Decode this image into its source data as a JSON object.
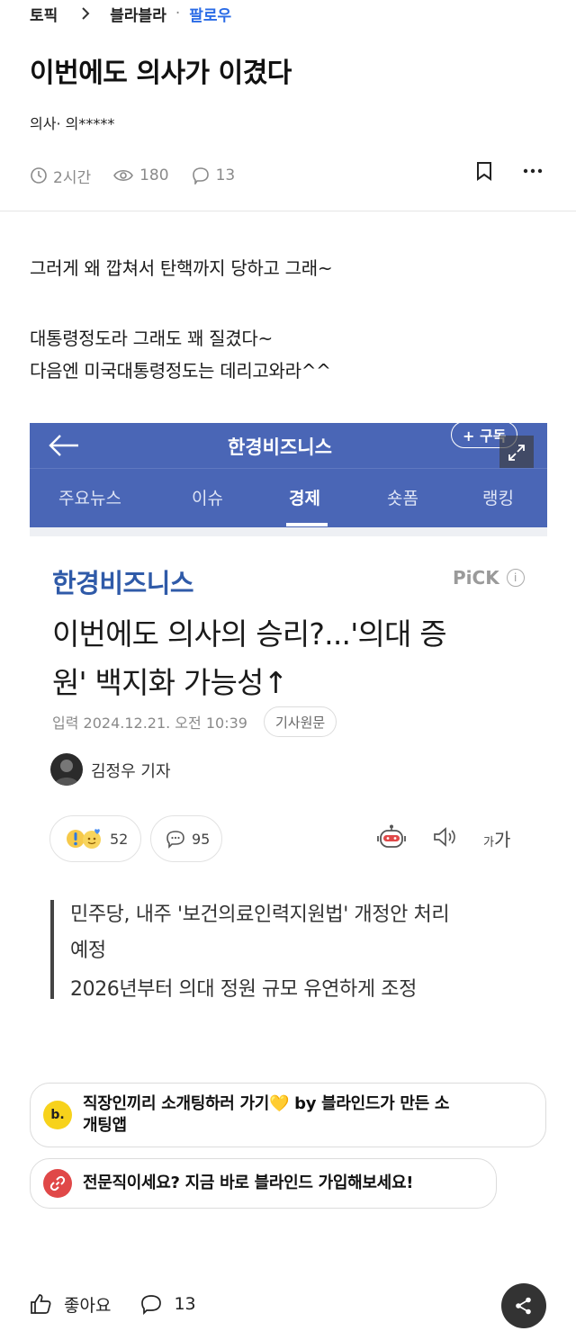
{
  "breadcrumb": {
    "topic": "토픽",
    "board": "블라블라",
    "separator": "·",
    "follow": "팔로우"
  },
  "post": {
    "title": "이번에도 의사가 이겼다",
    "author": "의사· 의*****",
    "time": "2시간",
    "views": "180",
    "comments": "13",
    "body": [
      "그러게 왜 깝쳐서 탄핵까지 당하고 그래~",
      "대통령정도라 그래도 꽤 질겼다~",
      "다음엔 미국대통령정도는 데리고와라^^"
    ]
  },
  "news": {
    "header_title": "한경비즈니스",
    "subscribe_label": "+ 구독",
    "tabs": [
      "주요뉴스",
      "이슈",
      "경제",
      "숏폼",
      "랭킹"
    ],
    "active_tab": "경제",
    "brand": "한경비즈니스",
    "pick_label": "PiCK",
    "pick_info": "i",
    "headline_line1": "이번에도 의사의 승리?...'의대 증",
    "headline_line2": "원' 백지화 가능성↑",
    "pubdate": "입력 2024.12.21. 오전 10:39",
    "origin_button": "기사원문",
    "reporter": "김정우 기자",
    "reaction_count": "52",
    "comment_count": "95",
    "font_size_label_small": "가",
    "font_size_label_big": "가",
    "summary": [
      "민주당, 내주 '보건의료인력지원법' 개정안 처리",
      "예정",
      "2026년부터 의대 정원 규모 유연하게 조정"
    ],
    "header_color": "#4a66b6",
    "brand_color": "#2f5aa8"
  },
  "promos": [
    {
      "line1": "직장인끼리 소개팅하러 가기💛 by 블라인드가 만든 소",
      "line2": "개팅앱",
      "badge_letter": "b.",
      "badge_color": "#f7d21b"
    },
    {
      "line1": "전문직이세요? 지금 바로 블라인드 가입해보세요!",
      "badge_icon": "link-icon",
      "badge_color": "#e04848"
    }
  ],
  "bottom": {
    "like_label": "좋아요",
    "comment_count": "13"
  },
  "colors": {
    "follow": "#2a6be6",
    "meta": "#8a8a8a"
  }
}
